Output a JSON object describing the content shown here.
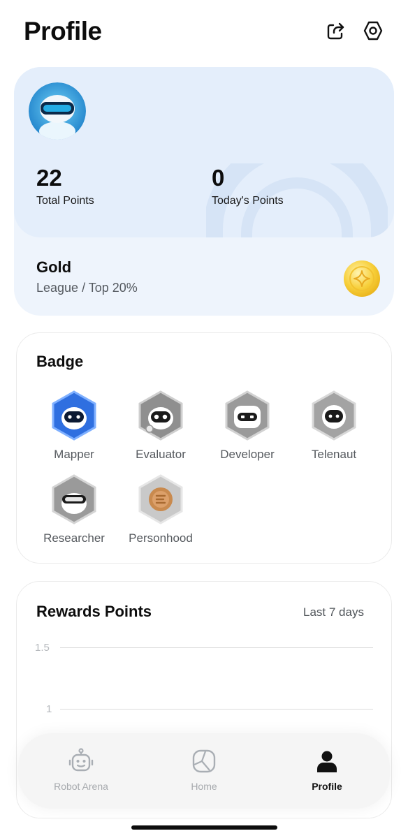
{
  "header": {
    "title": "Profile",
    "share_icon": "share-icon",
    "settings_icon": "gear-icon"
  },
  "profile": {
    "total_points": "22",
    "total_points_label": "Total Points",
    "today_points": "0",
    "today_points_label": "Today's Points",
    "league": {
      "name": "Gold",
      "subtitle": "League / Top 20%",
      "icon": "gold-coin-icon"
    }
  },
  "badges": {
    "title": "Badge",
    "items": [
      {
        "label": "Mapper",
        "icon": "mapper-badge-icon",
        "color": "#2f6fe0"
      },
      {
        "label": "Evaluator",
        "icon": "evaluator-badge-icon",
        "color": "#8a8a8a"
      },
      {
        "label": "Developer",
        "icon": "developer-badge-icon",
        "color": "#8a8a8a"
      },
      {
        "label": "Telenaut",
        "icon": "telenaut-badge-icon",
        "color": "#8a8a8a"
      },
      {
        "label": "Researcher",
        "icon": "researcher-badge-icon",
        "color": "#8a8a8a"
      },
      {
        "label": "Personhood",
        "icon": "personhood-badge-icon",
        "color": "#c98a4e"
      }
    ]
  },
  "rewards": {
    "title": "Rewards Points",
    "range": "Last 7 days",
    "y_ticks": [
      "1.5",
      "1"
    ]
  },
  "nav": {
    "items": [
      {
        "label": "Robot Arena",
        "icon": "robot-icon",
        "active": false
      },
      {
        "label": "Home",
        "icon": "home-icon",
        "active": false
      },
      {
        "label": "Profile",
        "icon": "profile-icon",
        "active": true
      }
    ]
  },
  "colors": {
    "card_bg": "#eef4fc",
    "card_top_bg": "#e4eefb",
    "accent_blue": "#2f6fe0",
    "gold": "#f5c518"
  }
}
